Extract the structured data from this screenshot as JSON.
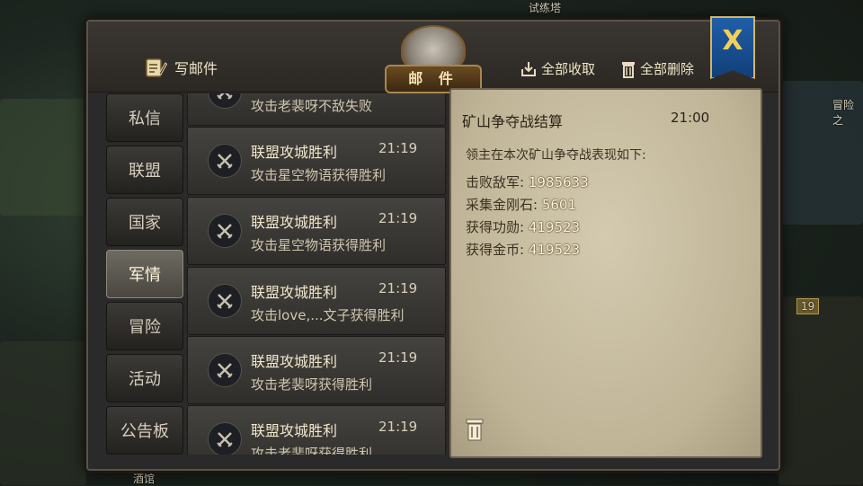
{
  "background": {
    "labels": [
      "试练塔",
      "冒险之",
      "酒馆"
    ],
    "badge": "19"
  },
  "header": {
    "title": "邮 件",
    "write_label": "写邮件",
    "collect_all_label": "全部收取",
    "delete_all_label": "全部删除",
    "close_label": "X"
  },
  "tabs": [
    {
      "label": "私信",
      "active": false
    },
    {
      "label": "联盟",
      "active": false
    },
    {
      "label": "国家",
      "active": false
    },
    {
      "label": "军情",
      "active": true
    },
    {
      "label": "冒险",
      "active": false
    },
    {
      "label": "活动",
      "active": false
    },
    {
      "label": "公告板",
      "active": false
    }
  ],
  "mails": [
    {
      "subject": "",
      "time": "",
      "summary": "攻击老裴呀不敌失败"
    },
    {
      "subject": "联盟攻城胜利",
      "time": "21:19",
      "summary": "攻击星空物语获得胜利"
    },
    {
      "subject": "联盟攻城胜利",
      "time": "21:19",
      "summary": "攻击星空物语获得胜利"
    },
    {
      "subject": "联盟攻城胜利",
      "time": "21:19",
      "summary": "攻击love,...文子获得胜利"
    },
    {
      "subject": "联盟攻城胜利",
      "time": "21:19",
      "summary": "攻击老裴呀获得胜利"
    },
    {
      "subject": "联盟攻城胜利",
      "time": "21:19",
      "summary": "攻击老裴呀获得胜利"
    }
  ],
  "detail": {
    "title": "矿山争夺战结算",
    "time": "21:00",
    "intro": "领主在本次矿山争夺战表现如下:",
    "stats": [
      {
        "label": "击败敌军:",
        "value": "1985633"
      },
      {
        "label": "采集金刚石:",
        "value": "5601"
      },
      {
        "label": "获得功勋:",
        "value": "419523"
      },
      {
        "label": "获得金币:",
        "value": "419523"
      }
    ]
  },
  "colors": {
    "accent_gold": "#f2cf5a",
    "close_blue": "#1f5fa8",
    "parchment": "#c9bfa3"
  }
}
